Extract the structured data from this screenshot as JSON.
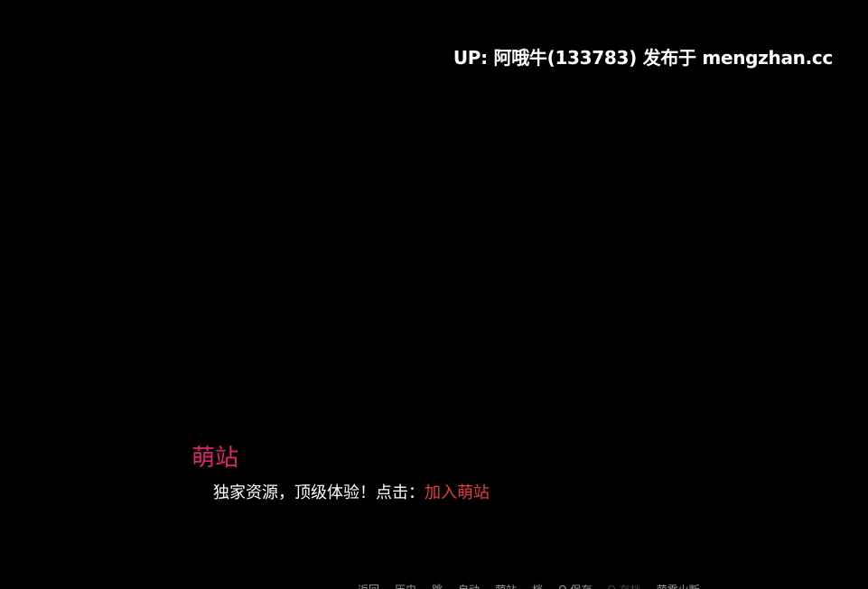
{
  "watermark": {
    "text": "UP: 阿哦牛(133783) 发布于 mengzhan.cc"
  },
  "dialogue": {
    "speaker": "萌站",
    "text_prefix": "独家资源，顶级体验！点击：",
    "link_text": "加入萌站"
  },
  "quick_menu": {
    "items": [
      {
        "label": "返回",
        "enabled": true
      },
      {
        "label": "历史",
        "enabled": true
      },
      {
        "label": "跳",
        "enabled": true
      },
      {
        "label": "自动",
        "enabled": true
      },
      {
        "label": "萌站",
        "enabled": true
      },
      {
        "label": "档",
        "enabled": true
      },
      {
        "label": "Q.保存",
        "enabled": true
      },
      {
        "label": "Q.存档",
        "enabled": false
      },
      {
        "label": "萌零火断",
        "enabled": true
      }
    ]
  },
  "colors": {
    "background": "#000000",
    "speaker": "#e0226e",
    "link": "#e83b3b",
    "text": "#ffffff",
    "menu": "#9a9a9a",
    "menu_disabled": "#444444"
  }
}
